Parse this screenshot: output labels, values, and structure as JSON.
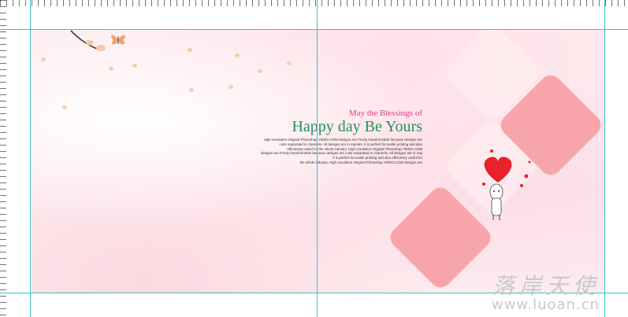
{
  "card": {
    "subtitle": "May the Blessings of",
    "title": "Happy day Be Yours",
    "paragraph": [
      "High resolution Original Photoshop YIEDO.COM designs are Freely transformable because designs are",
      "color separated in channels. All designs are in repeats. It is perfect for textile printing and also",
      "effectively useful for the whole industry. High resolution Original Photoshop YIEDO.COM",
      "designs are Freely transformable because designs are color separated in channels. All designs are in repeats.",
      "It is perfect for textile printing and also effectively useful for",
      "the whole industry. High resolution Original Photoshop YIEDO.COM designs are"
    ]
  },
  "watermark": {
    "chinese": "落岸天使",
    "url": "www.luoan.cn"
  },
  "colors": {
    "title_green": "#27905a",
    "subtitle_magenta": "#e23a7a",
    "diamond_pink": "#f7a5aa",
    "heart_red": "#e8212a",
    "guide_cyan": "#34c4d3"
  },
  "icons": [
    "branch-icon",
    "butterfly-icon",
    "heart-icon",
    "cartoon-character-icon"
  ]
}
